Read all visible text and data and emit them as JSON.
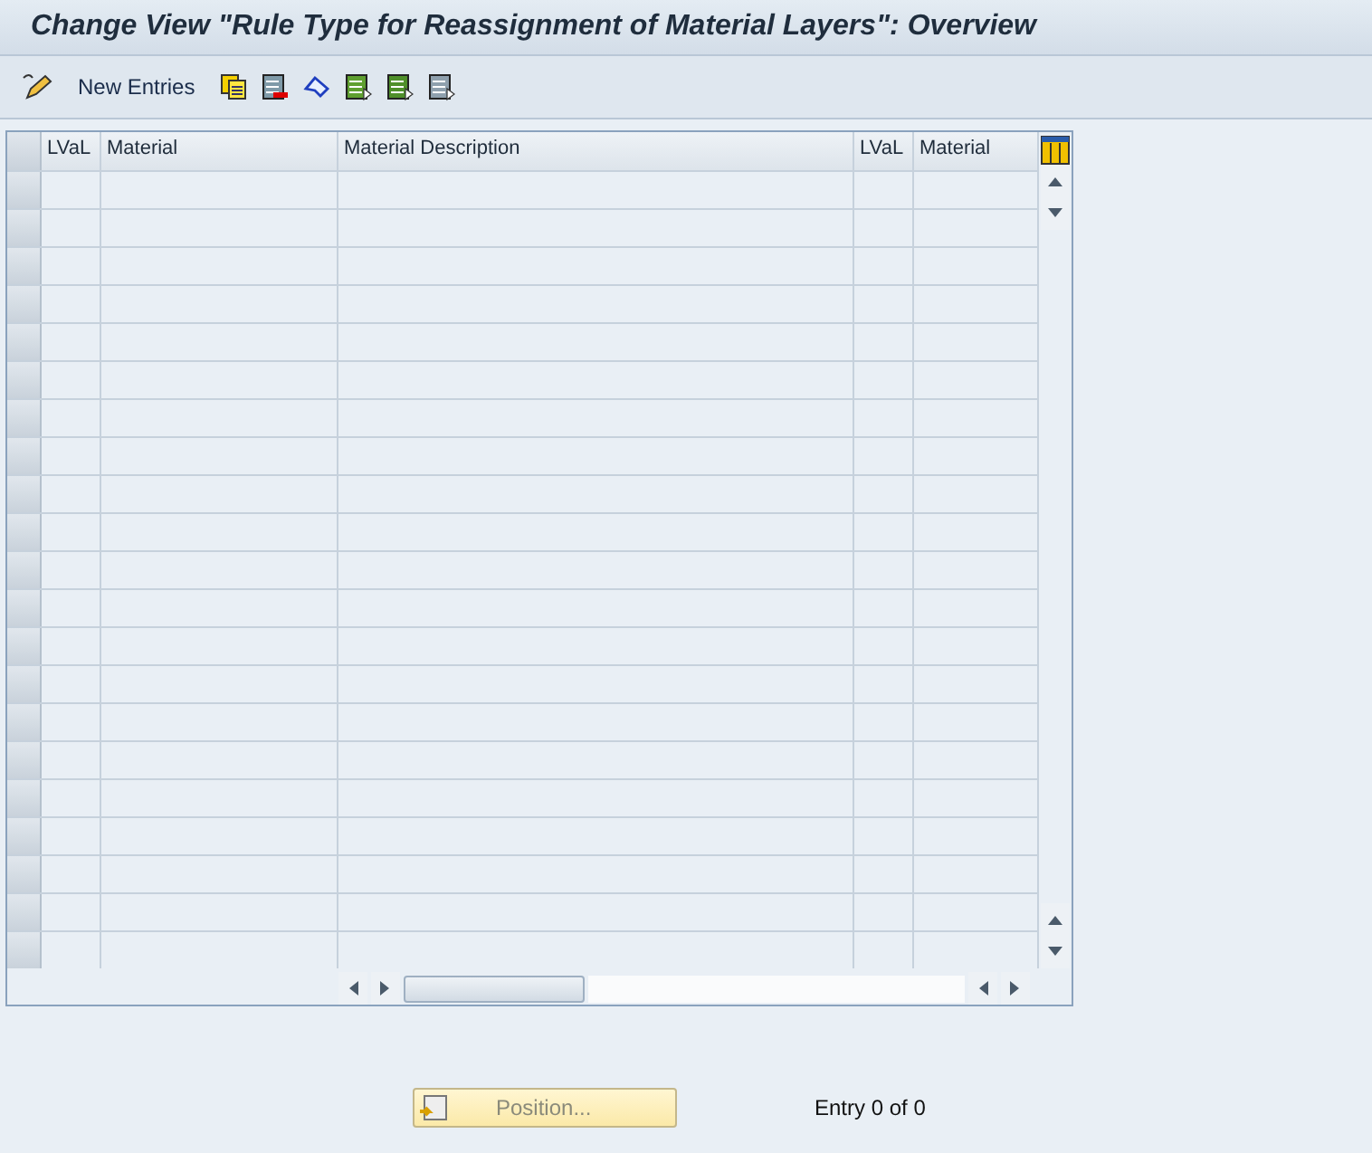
{
  "window": {
    "title": "Change View \"Rule Type for Reassignment of Material Layers\": Overview"
  },
  "toolbar": {
    "new_entries": "New Entries"
  },
  "table": {
    "columns": [
      "LVaL",
      "Material",
      "Material Description",
      "LVaL",
      "Material"
    ]
  },
  "footer": {
    "position_button": "Position...",
    "entry_count": "Entry 0 of 0"
  }
}
